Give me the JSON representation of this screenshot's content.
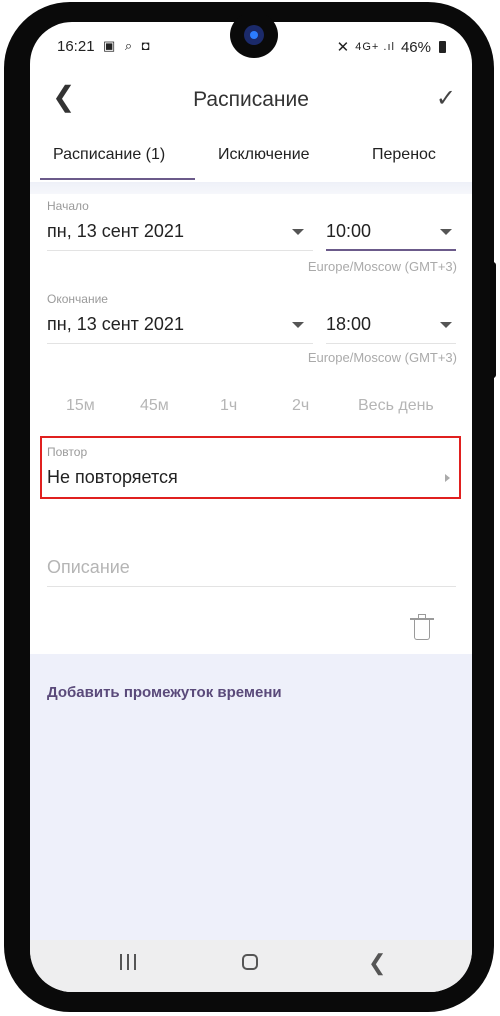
{
  "status_bar": {
    "time": "16:21",
    "left_icons": "▣ ⌕ ◘",
    "right_icons": "✕",
    "network": "4G+ .ıl",
    "battery": "46%"
  },
  "app_bar": {
    "back_icon": "chevron-left",
    "title": "Расписание",
    "confirm_icon": "check"
  },
  "tabs": [
    {
      "label": "Расписание (1)",
      "selected": true
    },
    {
      "label": "Исключение",
      "selected": false
    },
    {
      "label": "Перенос",
      "selected": false
    }
  ],
  "start": {
    "label": "Начало",
    "date": "пн, 13 сент 2021",
    "time": "10:00",
    "timezone": "Europe/Moscow (GMT+3)"
  },
  "end": {
    "label": "Окончание",
    "date": "пн, 13 сент 2021",
    "time": "18:00",
    "timezone": "Europe/Moscow (GMT+3)"
  },
  "durations": [
    "15м",
    "45м",
    "1ч",
    "2ч",
    "Весь день"
  ],
  "repeat": {
    "label": "Повтор",
    "value": "Не повторяется"
  },
  "description": {
    "placeholder": "Описание"
  },
  "add_time_slot": "Добавить промежуток времени",
  "colors": {
    "accent": "#6b5a8a",
    "highlight_border": "#e0201f",
    "footer_bg": "#eef0fa"
  }
}
